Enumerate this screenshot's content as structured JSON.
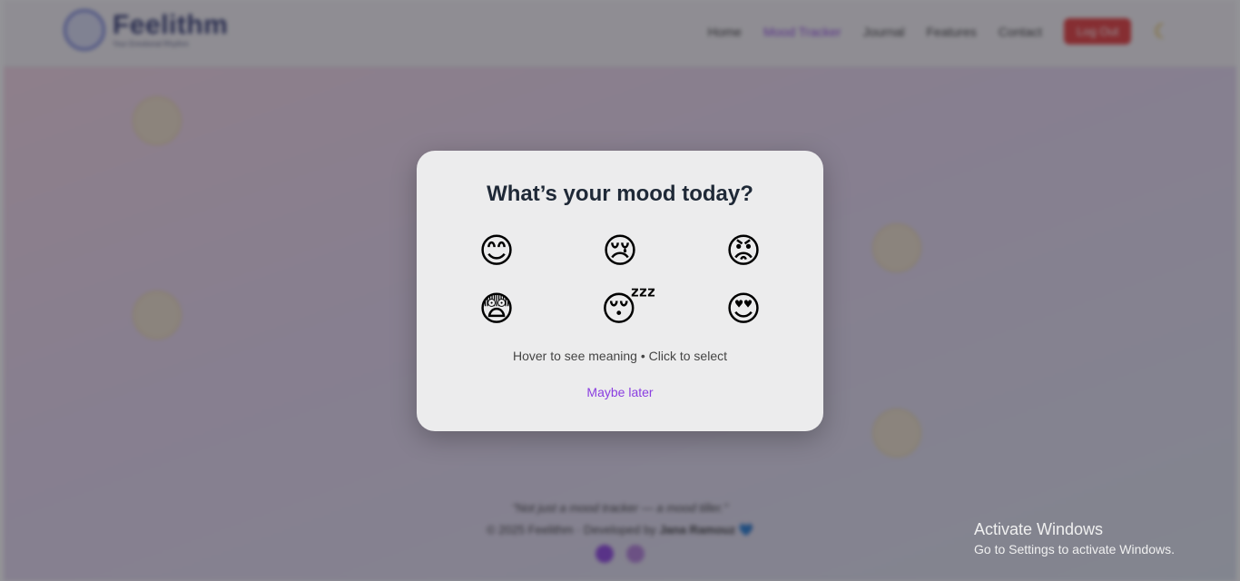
{
  "header": {
    "logo_name": "Feelithm",
    "logo_tagline": "Your Emotional Rhythm",
    "nav": [
      "Home",
      "Mood Tracker",
      "Journal",
      "Features",
      "Contact"
    ],
    "login_label": "Log Out",
    "theme_icon": "moon-icon"
  },
  "footer": {
    "quote": "\"Not just a mood tracker — a mood tiller.\"",
    "copyright": "© 2025 Feelithm · Developed by",
    "author": "Jana Ramouz",
    "heart": "💙"
  },
  "modal": {
    "title": "What’s your mood today?",
    "moods": [
      {
        "emoji": "😊",
        "name": "happy"
      },
      {
        "emoji": "😢",
        "name": "sad"
      },
      {
        "emoji": "😡",
        "name": "angry"
      },
      {
        "emoji": "😨",
        "name": "anxious"
      },
      {
        "emoji": "😴",
        "name": "sleepy"
      },
      {
        "emoji": "😍",
        "name": "loving"
      }
    ],
    "hint": "Hover to see meaning • Click to select",
    "dismiss_label": "Maybe later"
  },
  "watermark": {
    "title": "Activate Windows",
    "subtitle": "Go to Settings to activate Windows."
  },
  "colors": {
    "accent": "#8a3ee0",
    "logout": "#e53535",
    "title": "#1f2937"
  }
}
